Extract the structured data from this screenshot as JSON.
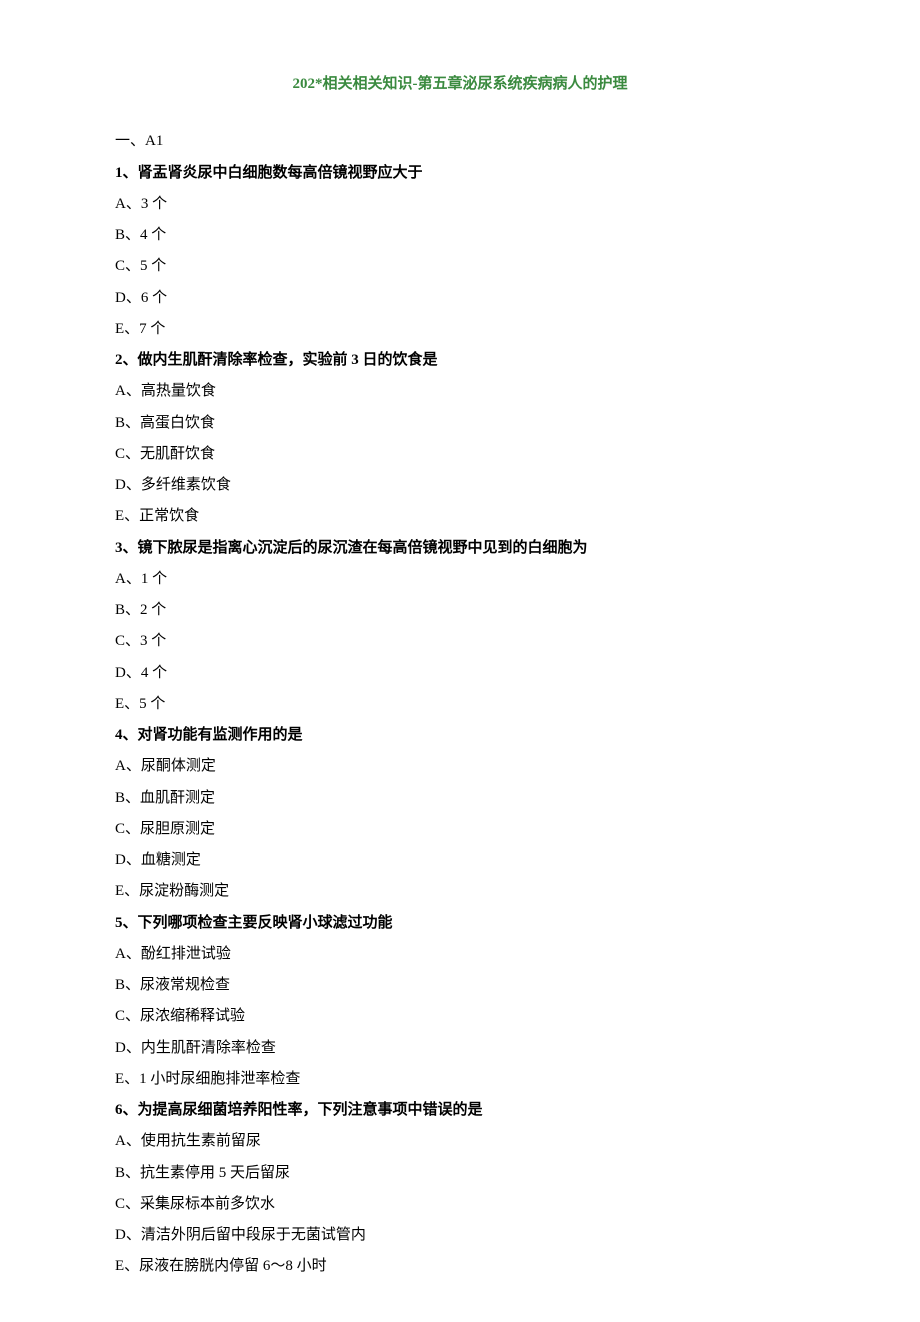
{
  "title": "202*相关相关知识-第五章泌尿系统疾病病人的护理",
  "section_label": "一、A1",
  "questions": [
    {
      "stem": "1、肾盂肾炎尿中白细胞数每高倍镜视野应大于",
      "options": [
        "A、3 个",
        "B、4 个",
        "C、5 个",
        "D、6 个",
        "E、7 个"
      ]
    },
    {
      "stem": "2、做内生肌酐清除率检查，实验前 3 日的饮食是",
      "options": [
        "A、高热量饮食",
        "B、高蛋白饮食",
        "C、无肌酐饮食",
        "D、多纤维素饮食",
        "E、正常饮食"
      ]
    },
    {
      "stem": "3、镜下脓尿是指离心沉淀后的尿沉渣在每高倍镜视野中见到的白细胞为",
      "options": [
        "A、1 个",
        "B、2 个",
        "C、3 个",
        "D、4 个",
        "E、5 个"
      ]
    },
    {
      "stem": "4、对肾功能有监测作用的是",
      "options": [
        "A、尿酮体测定",
        "B、血肌酐测定",
        "C、尿胆原测定",
        "D、血糖测定",
        "E、尿淀粉酶测定"
      ]
    },
    {
      "stem": "5、下列哪项检查主要反映肾小球滤过功能",
      "options": [
        "A、酚红排泄试验",
        "B、尿液常规检查",
        "C、尿浓缩稀释试验",
        "D、内生肌酐清除率检查",
        "E、1 小时尿细胞排泄率检查"
      ]
    },
    {
      "stem": "6、为提高尿细菌培养阳性率，下列注意事项中错误的是",
      "options": [
        "A、使用抗生素前留尿",
        "B、抗生素停用 5 天后留尿",
        "C、采集尿标本前多饮水",
        "D、清洁外阴后留中段尿于无菌试管内",
        "E、尿液在膀胱内停留 6～8 小时"
      ]
    }
  ]
}
